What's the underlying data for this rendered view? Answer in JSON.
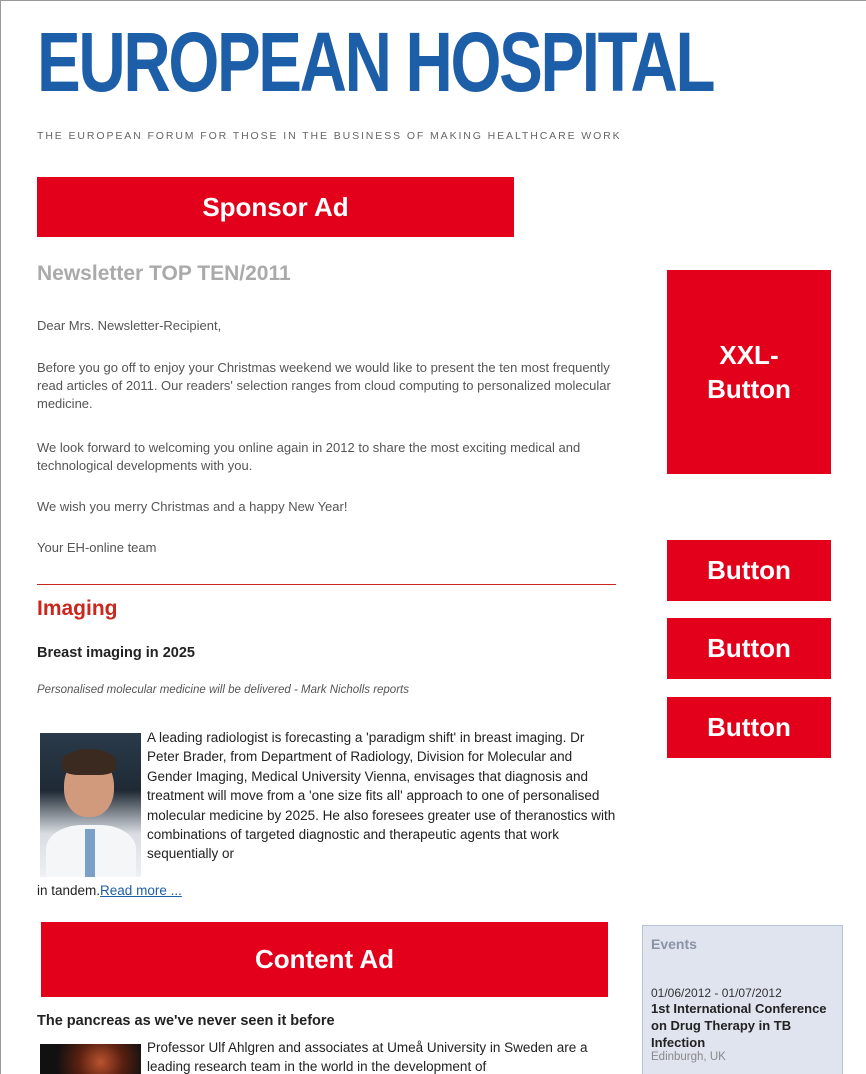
{
  "header": {
    "logo_title": "EUROPEAN HOSPITAL",
    "tagline": "THE EUROPEAN FORUM FOR THOSE IN THE BUSINESS OF MAKING HEALTHCARE WORK"
  },
  "ads": {
    "sponsor": "Sponsor Ad",
    "xxl": "XXL-Button",
    "button1": "Button",
    "button2": "Button",
    "button3": "Button",
    "content": "Content Ad"
  },
  "newsletter": {
    "title": "Newsletter TOP TEN/2011",
    "greeting": "Dear Mrs. Newsletter-Recipient,",
    "para1": "Before you go off to enjoy your Christmas weekend we would like to present the ten most frequently read articles of 2011. Our readers' selection ranges from cloud computing to personalized molecular medicine.",
    "para2": "We look forward to welcoming you online again in 2012 to share the most exciting medical and technological developments with you.",
    "para3": "We wish you merry Christmas and a happy New Year!",
    "signoff": "Your EH-online team"
  },
  "section": {
    "heading": "Imaging",
    "article1": {
      "title": "Breast imaging in 2025",
      "subtitle": "Personalised molecular medicine will be delivered - Mark Nicholls reports",
      "body": "A leading radiologist is forecasting a 'paradigm shift' in breast imaging. Dr Peter Brader, from Department of Radiology, Division for Molecular and Gender Imaging, Medical University Vienna, envisages that diagnosis and treatment will move from a 'one size fits all' approach to one of personalised molecular medicine by 2025. He also foresees greater use of theranostics with combinations of targeted diagnostic and therapeutic agents that work sequentially or",
      "tail": "in tandem.",
      "read_more": "Read more ..."
    },
    "article2": {
      "title": "The pancreas as we've never seen it before",
      "body": "Professor Ulf Ahlgren and associates at Umeå University in Sweden are a leading research team in the world in the development of"
    }
  },
  "events": {
    "title": "Events",
    "date": "01/06/2012 - 01/07/2012",
    "name": "1st International Conference on Drug Therapy in TB Infection",
    "location": "Edinburgh, UK"
  }
}
